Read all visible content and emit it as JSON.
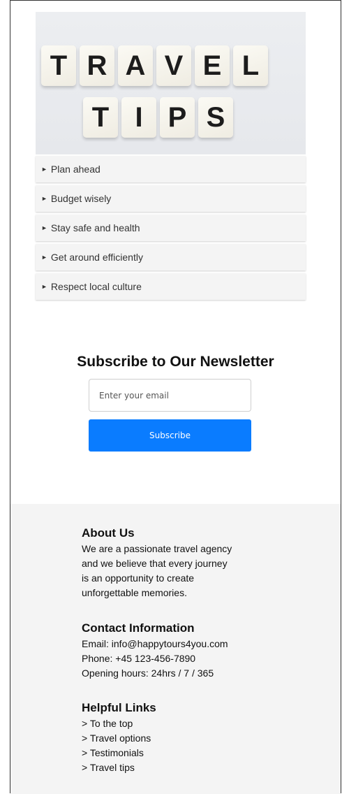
{
  "hero": {
    "row1": [
      "T",
      "R",
      "A",
      "V",
      "E",
      "L"
    ],
    "row2": [
      "T",
      "I",
      "P",
      "S"
    ]
  },
  "tips": [
    {
      "label": "Plan ahead"
    },
    {
      "label": "Budget wisely"
    },
    {
      "label": "Stay safe and health"
    },
    {
      "label": "Get around efficiently"
    },
    {
      "label": "Respect local culture"
    }
  ],
  "newsletter": {
    "title": "Subscribe to Our Newsletter",
    "email_placeholder": "Enter your email",
    "email_value": "",
    "button_label": "Subscribe",
    "button_color": "#0a7cff"
  },
  "footer": {
    "about": {
      "title": "About Us",
      "lines": [
        "We are a passionate travel agency",
        "and we believe that every journey",
        "is an opportunity to create",
        "unforgettable memories."
      ]
    },
    "contact": {
      "title": "Contact Information",
      "email": "Email: info@happytours4you.com",
      "phone": "Phone: +45 123-456-7890",
      "hours": "Opening hours: 24hrs / 7 / 365"
    },
    "links": {
      "title": "Helpful Links",
      "items": [
        "> To the top",
        "> Travel options",
        "> Testimonials",
        "> Travel tips"
      ]
    }
  }
}
